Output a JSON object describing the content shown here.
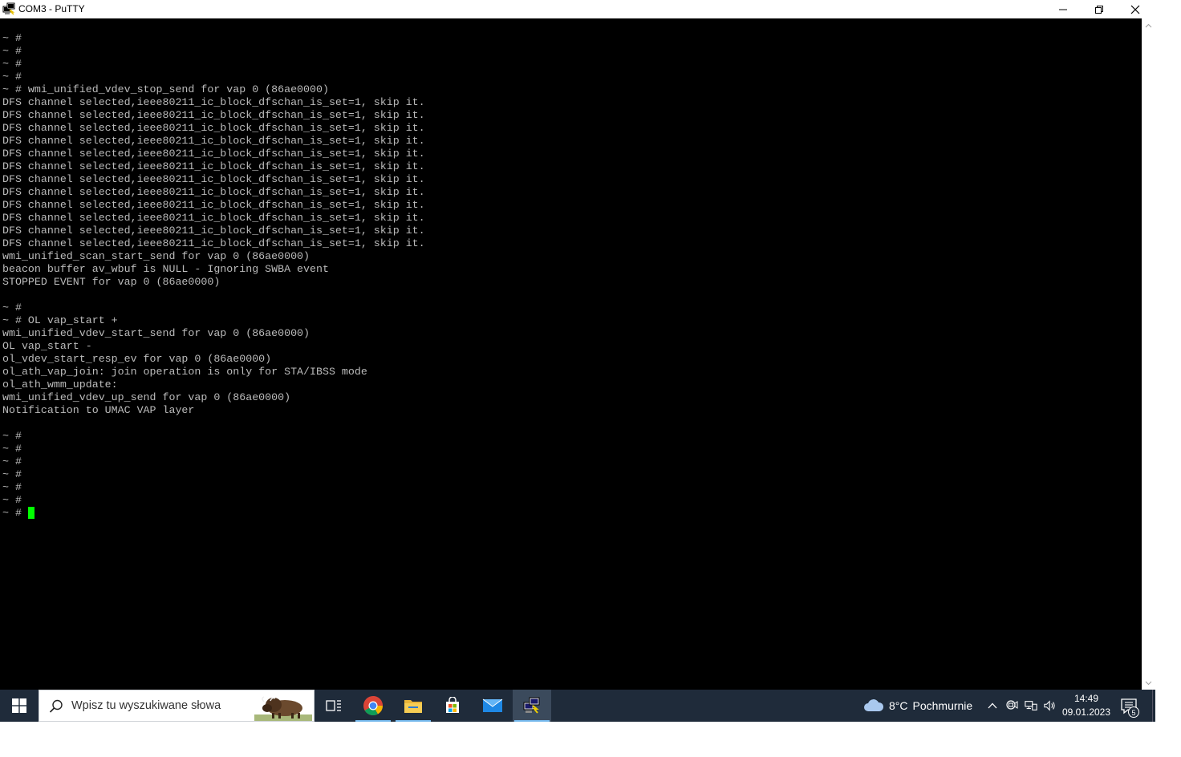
{
  "window": {
    "title": "COM3 - PuTTY"
  },
  "terminal": {
    "lines": [
      "~ #",
      "~ #",
      "~ #",
      "~ #",
      "~ # wmi_unified_vdev_stop_send for vap 0 (86ae0000)",
      "DFS channel selected,ieee80211_ic_block_dfschan_is_set=1, skip it.",
      "DFS channel selected,ieee80211_ic_block_dfschan_is_set=1, skip it.",
      "DFS channel selected,ieee80211_ic_block_dfschan_is_set=1, skip it.",
      "DFS channel selected,ieee80211_ic_block_dfschan_is_set=1, skip it.",
      "DFS channel selected,ieee80211_ic_block_dfschan_is_set=1, skip it.",
      "DFS channel selected,ieee80211_ic_block_dfschan_is_set=1, skip it.",
      "DFS channel selected,ieee80211_ic_block_dfschan_is_set=1, skip it.",
      "DFS channel selected,ieee80211_ic_block_dfschan_is_set=1, skip it.",
      "DFS channel selected,ieee80211_ic_block_dfschan_is_set=1, skip it.",
      "DFS channel selected,ieee80211_ic_block_dfschan_is_set=1, skip it.",
      "DFS channel selected,ieee80211_ic_block_dfschan_is_set=1, skip it.",
      "DFS channel selected,ieee80211_ic_block_dfschan_is_set=1, skip it.",
      "wmi_unified_scan_start_send for vap 0 (86ae0000)",
      "beacon buffer av_wbuf is NULL - Ignoring SWBA event",
      "STOPPED EVENT for vap 0 (86ae0000)",
      "",
      "~ #",
      "~ # OL vap_start +",
      "wmi_unified_vdev_start_send for vap 0 (86ae0000)",
      "OL vap_start -",
      "ol_vdev_start_resp_ev for vap 0 (86ae0000)",
      "ol_ath_vap_join: join operation is only for STA/IBSS mode",
      "ol_ath_wmm_update:",
      "wmi_unified_vdev_up_send for vap 0 (86ae0000)",
      "Notification to UMAC VAP layer",
      "",
      "~ #",
      "~ #",
      "~ #",
      "~ #",
      "~ #",
      "~ #"
    ],
    "prompt": "~ # ",
    "text_color": "#bbbbbb",
    "background": "#000000",
    "cursor_color": "#00ff00"
  },
  "taskbar": {
    "search_placeholder": "Wpisz tu wyszukiwane słowa",
    "weather_temp": "8°C",
    "weather_desc": "Pochmurnie",
    "time": "14:49",
    "date": "09.01.2023",
    "notification_count": "5",
    "apps": [
      {
        "icon": "task-view-icon"
      },
      {
        "icon": "chrome-icon"
      },
      {
        "icon": "file-explorer-icon"
      },
      {
        "icon": "microsoft-store-icon"
      },
      {
        "icon": "mail-icon"
      },
      {
        "icon": "putty-icon"
      }
    ]
  }
}
